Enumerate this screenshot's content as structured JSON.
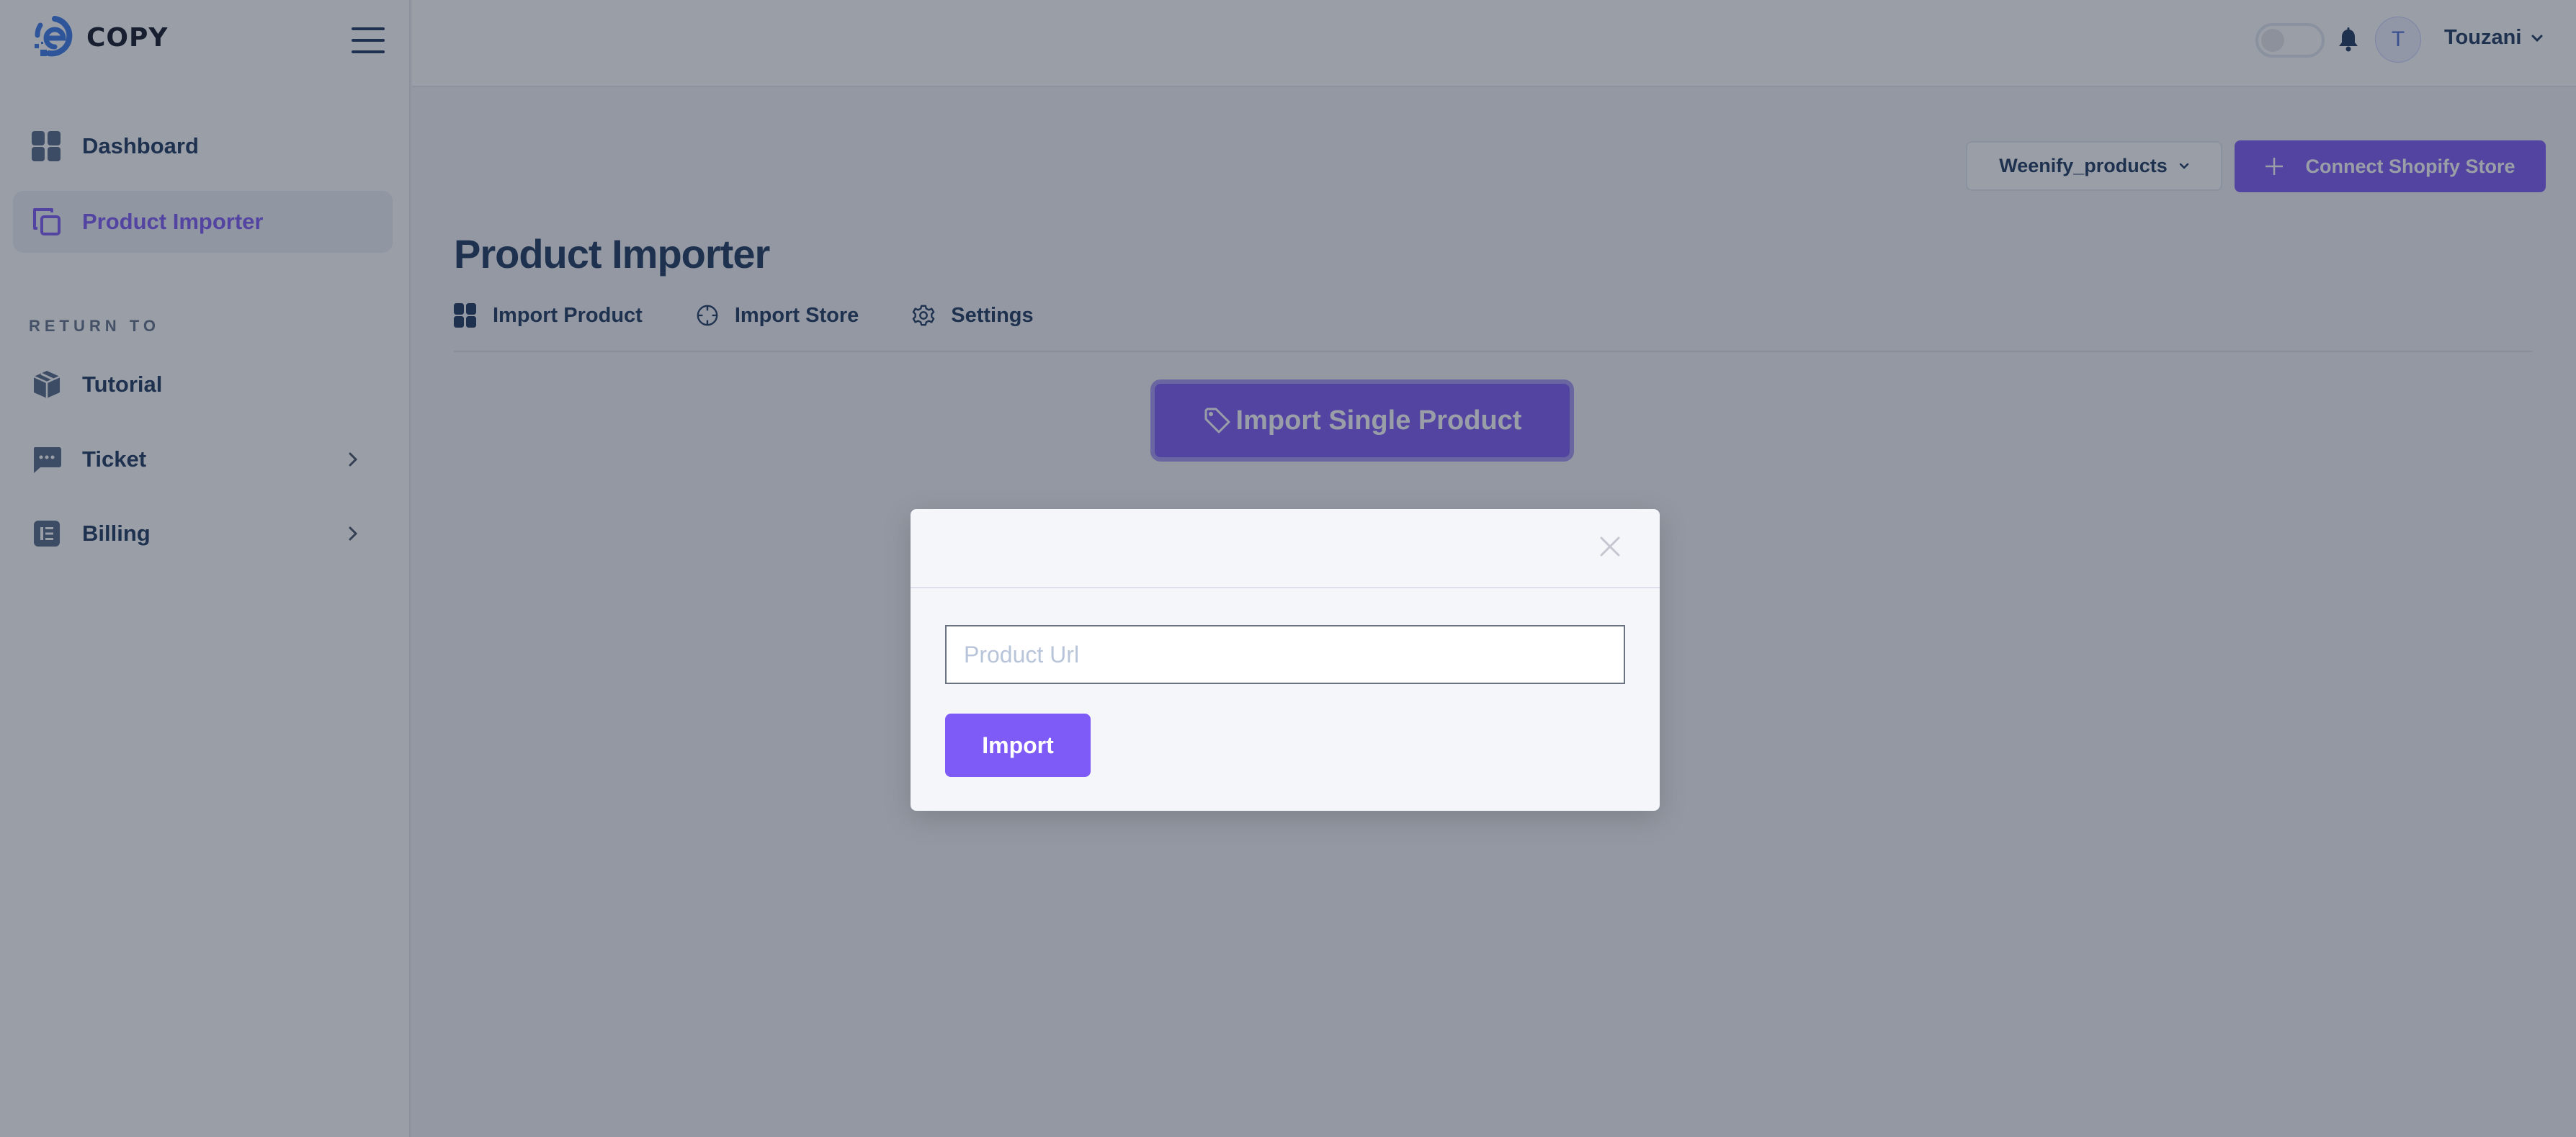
{
  "brand": {
    "name": "COPY",
    "logo_icon": "e-logo-icon"
  },
  "sidebar": {
    "menu_icon": "hamburger-icon",
    "items": [
      {
        "label": "Dashboard",
        "icon": "grid-icon",
        "active": false
      },
      {
        "label": "Product Importer",
        "icon": "copy-icon",
        "active": true
      }
    ],
    "section_label": "RETURN TO",
    "return_items": [
      {
        "label": "Tutorial",
        "icon": "box-icon",
        "has_submenu": false
      },
      {
        "label": "Ticket",
        "icon": "chat-icon",
        "has_submenu": true
      },
      {
        "label": "Billing",
        "icon": "list-icon",
        "has_submenu": true
      }
    ]
  },
  "header": {
    "theme_toggle": {
      "icon": "toggle-icon",
      "state": "off"
    },
    "notification_icon": "bell-icon",
    "avatar_initial": "T",
    "user_name": "Touzani"
  },
  "toolbar": {
    "store_select": {
      "value": "Weenify_products"
    },
    "connect_button": "Connect Shopify Store"
  },
  "page": {
    "title": "Product Importer",
    "tabs": [
      {
        "label": "Import Product",
        "icon": "grid-icon"
      },
      {
        "label": "Import Store",
        "icon": "crosshair-icon"
      },
      {
        "label": "Settings",
        "icon": "gear-icon"
      }
    ],
    "single_product_button": "Import Single Product"
  },
  "modal": {
    "input": {
      "placeholder": "Product Url",
      "value": ""
    },
    "import_button": "Import",
    "close_icon": "close-icon"
  },
  "colors": {
    "accent": "#7e5bf6",
    "text": "#1e3a5f",
    "logo_blue": "#3b82f6"
  }
}
